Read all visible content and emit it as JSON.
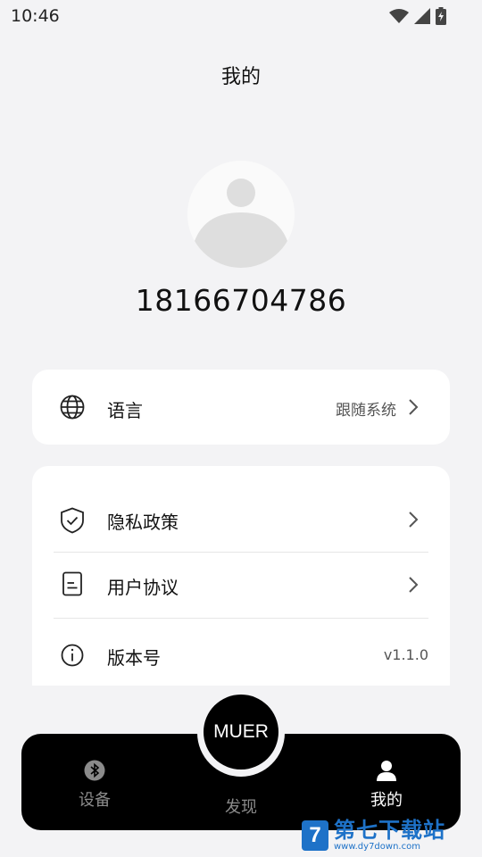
{
  "status_bar": {
    "time": "10:46",
    "icons": [
      "wifi-icon",
      "signal-icon",
      "battery-charging-icon"
    ]
  },
  "header": {
    "title": "我的"
  },
  "profile": {
    "phone": "18166704786",
    "avatar_icon": "default-avatar-icon"
  },
  "language_card": {
    "label": "语言",
    "value": "跟随系统",
    "icon": "globe-icon"
  },
  "settings_card": {
    "items": [
      {
        "label": "隐私政策",
        "icon": "shield-check-icon"
      },
      {
        "label": "用户协议",
        "icon": "document-icon"
      },
      {
        "label": "版本号",
        "icon": "info-icon",
        "value": "v1.1.0"
      }
    ]
  },
  "bottom_nav": {
    "center_label": "MUER",
    "items": [
      {
        "label": "设备",
        "icon": "bluetooth-icon",
        "active": false
      },
      {
        "label": "发现",
        "active": false
      },
      {
        "label": "我的",
        "icon": "user-icon",
        "active": true
      }
    ]
  },
  "watermark": {
    "name": "第七下载站",
    "url": "www.dy7down.com"
  },
  "colors": {
    "background": "#f3f3f5",
    "card": "#ffffff",
    "nav_bg": "#000000",
    "nav_active": "#ffffff",
    "nav_inactive": "#8b8b8b",
    "watermark": "#1e72c8"
  }
}
